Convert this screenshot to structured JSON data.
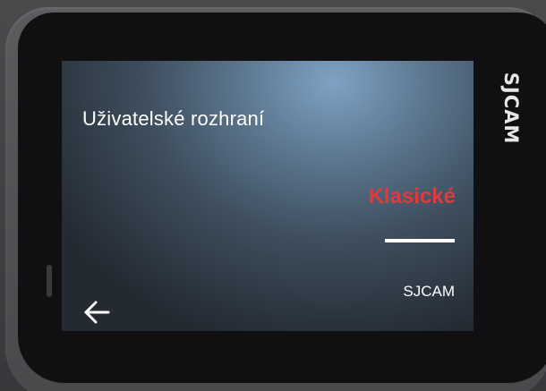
{
  "screen": {
    "title": "Uživatelské rozhraní",
    "options": [
      {
        "label": "Klasické",
        "selected": true
      },
      {
        "label": "SJCAM",
        "selected": false
      }
    ],
    "back_icon": "arrow-left-icon"
  },
  "device": {
    "brand_logo": "SJCAM"
  },
  "colors": {
    "selected": "#e03a3e",
    "text": "#ffffff"
  }
}
